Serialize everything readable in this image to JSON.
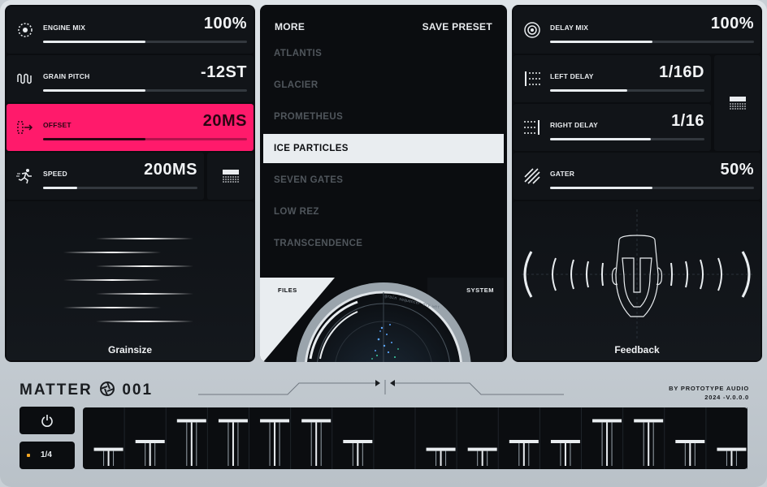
{
  "colors": {
    "accent": "#ff1a6b",
    "panel": "#0b0d10",
    "cell": "#111418",
    "chassis": "#cfd5da"
  },
  "left_panel": {
    "params": [
      {
        "name": "engine-mix",
        "icon": "dial-icon",
        "label": "ENGINE MIX",
        "value": "100%",
        "level": 0.5
      },
      {
        "name": "grain-pitch",
        "icon": "wave-icon",
        "label": "GRAIN PITCH",
        "value": "-12ST",
        "level": 0.5
      },
      {
        "name": "offset",
        "icon": "offset-arrow-icon",
        "label": "OFFSET",
        "value": "20MS",
        "level": 0.5
      },
      {
        "name": "speed",
        "icon": "runner-icon",
        "label": "SPEED",
        "value": "200MS",
        "level": 0.22
      }
    ],
    "section_label": "Grainsize"
  },
  "center_panel": {
    "more_label": "MORE",
    "save_label": "SAVE PRESET",
    "presets": [
      "ATLANTIS",
      "GLACIER",
      "PROMETHEUS",
      "ICE PARTICLES",
      "SEVEN GATES",
      "LOW REZ",
      "TRANSCENDENCE"
    ],
    "selected_preset": "ICE PARTICLES",
    "tabs": {
      "files": "FILES",
      "system": "SYSTEM"
    },
    "scope_text": "grain sequencer dry wet"
  },
  "right_panel": {
    "params": [
      {
        "name": "delay-mix",
        "icon": "target-icon",
        "label": "DELAY MIX",
        "value": "100%",
        "level": 0.5
      },
      {
        "name": "left-delay",
        "icon": "dot-grid-icon",
        "label": "LEFT DELAY",
        "value": "1/16D",
        "level": 0.5
      },
      {
        "name": "right-delay",
        "icon": "dot-grid-icon",
        "label": "RIGHT DELAY",
        "value": "1/16",
        "level": 0.65
      },
      {
        "name": "gater",
        "icon": "diagonal-lines-icon",
        "label": "GATER",
        "value": "50%",
        "level": 0.5
      }
    ],
    "section_label": "Feedback"
  },
  "bottom": {
    "brand_left": "MATTER",
    "brand_right": "001",
    "maker": "BY PROTOTYPE AUDIO",
    "version": "2024 -V.0.0.0",
    "rate_label": "1/4",
    "steps": [
      0.35,
      0.5,
      0.9,
      0.9,
      0.9,
      0.9,
      0.5,
      0.35,
      0.35,
      0.5,
      0.5,
      0.9,
      0.9,
      0.5,
      0.35
    ]
  }
}
